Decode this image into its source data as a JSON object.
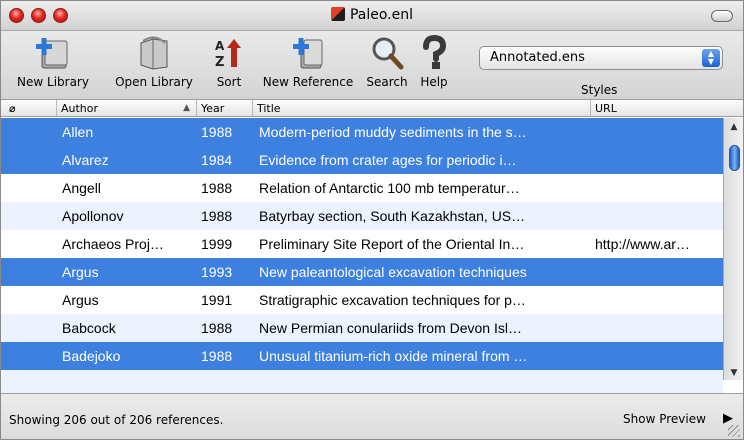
{
  "window": {
    "title": "Paleo.enl"
  },
  "toolbar": {
    "new_library": "New Library",
    "open_library": "Open Library",
    "sort": "Sort",
    "new_reference": "New Reference",
    "search": "Search",
    "help": "Help",
    "styles_value": "Annotated.ens",
    "styles_label": "Styles"
  },
  "columns": {
    "attach": "",
    "author": "Author",
    "year": "Year",
    "title": "Title",
    "url": "URL"
  },
  "rows": [
    {
      "author": "Allen",
      "year": "1988",
      "title": "Modern-period muddy sediments in the s…",
      "url": "",
      "selected": true
    },
    {
      "author": "Alvarez",
      "year": "1984",
      "title": "Evidence from crater ages for periodic i…",
      "url": "",
      "selected": true
    },
    {
      "author": "Angell",
      "year": "1988",
      "title": "Relation of Antarctic 100 mb temperatur…",
      "url": "",
      "selected": false
    },
    {
      "author": "Apollonov",
      "year": "1988",
      "title": "Batyrbay section, South Kazakhstan, US…",
      "url": "",
      "selected": false
    },
    {
      "author": "Archaeos Proj…",
      "year": "1999",
      "title": "Preliminary Site Report of the Oriental In…",
      "url": "http://www.ar…",
      "selected": false
    },
    {
      "author": "Argus",
      "year": "1993",
      "title": "New paleantological excavation techniques",
      "url": "",
      "selected": true
    },
    {
      "author": "Argus",
      "year": "1991",
      "title": "Stratigraphic excavation techniques for p…",
      "url": "",
      "selected": false
    },
    {
      "author": "Babcock",
      "year": "1988",
      "title": "New Permian conulariids from Devon Isl…",
      "url": "",
      "selected": false
    },
    {
      "author": "Badejoko",
      "year": "1988",
      "title": "Unusual titanium-rich oxide mineral from …",
      "url": "",
      "selected": true
    }
  ],
  "status": {
    "text": "Showing 206 out of 206 references.",
    "show_preview": "Show Preview"
  },
  "icons": {
    "attach_header": "paperclip-icon",
    "sort_indicator": "sort-ascending-icon"
  },
  "colors": {
    "selection": "#3d80df",
    "stripe": "#edf3fe"
  }
}
